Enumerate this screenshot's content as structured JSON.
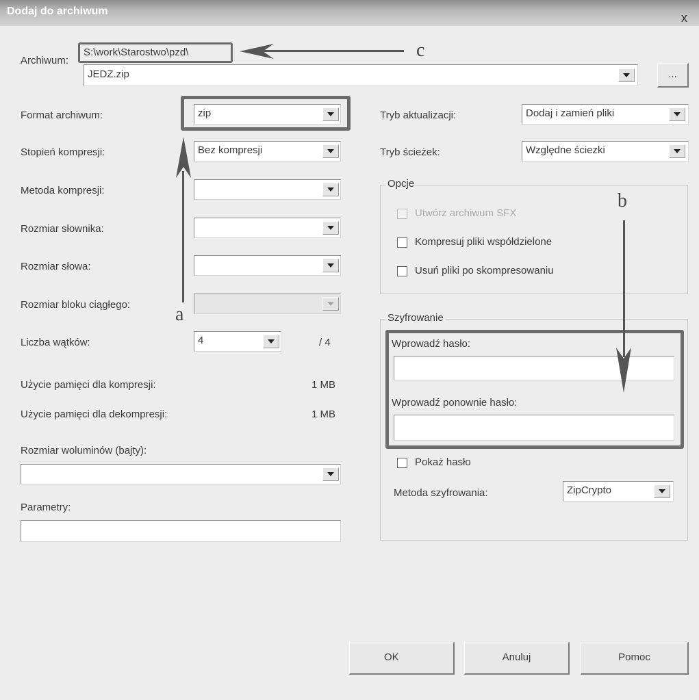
{
  "dialog": {
    "title": "Dodaj do archiwum",
    "close": "x"
  },
  "archive": {
    "label": "Archiwum:",
    "path": "S:\\work\\Starostwo\\pzd\\",
    "filename": "JEDZ.zip",
    "browse_label": "..."
  },
  "left": {
    "format_label": "Format archiwum:",
    "format_value": "zip",
    "level_label": "Stopień kompresji:",
    "level_value": "Bez kompresji",
    "method_label": "Metoda kompresji:",
    "method_value": "",
    "dict_label": "Rozmiar słownika:",
    "dict_value": "",
    "word_label": "Rozmiar słowa:",
    "word_value": "",
    "block_label": "Rozmiar bloku ciągłego:",
    "block_value": "",
    "threads_label": "Liczba wątków:",
    "threads_value": "4",
    "threads_max": "/ 4",
    "mem_comp_label": "Użycie pamięci dla kompresji:",
    "mem_comp_value": "1 MB",
    "mem_decomp_label": "Użycie pamięci dla dekompresji:",
    "mem_decomp_value": "1 MB",
    "volume_label": "Rozmiar woluminów (bajty):",
    "volume_value": "",
    "params_label": "Parametry:",
    "params_value": ""
  },
  "right": {
    "update_label": "Tryb aktualizacji:",
    "update_value": "Dodaj i zamień pliki",
    "paths_label": "Tryb ścieżek:",
    "paths_value": "Względne ściezki",
    "options_title": "Opcje",
    "opt_sfx": "Utwórz archiwum SFX",
    "opt_shared": "Kompresuj pliki współdzielone",
    "opt_delete": "Usuń pliki po skompresowaniu",
    "enc_title": "Szyfrowanie",
    "pass_label": "Wprowadź hasło:",
    "pass_value": "",
    "pass2_label": "Wprowadź ponownie hasło:",
    "pass2_value": "",
    "show_pass": "Pokaż hasło",
    "enc_method_label": "Metoda szyfrowania:",
    "enc_method_value": "ZipCrypto"
  },
  "buttons": {
    "ok": "OK",
    "cancel": "Anuluj",
    "help": "Pomoc"
  },
  "annotations": {
    "a": "a",
    "b": "b",
    "c": "c"
  }
}
